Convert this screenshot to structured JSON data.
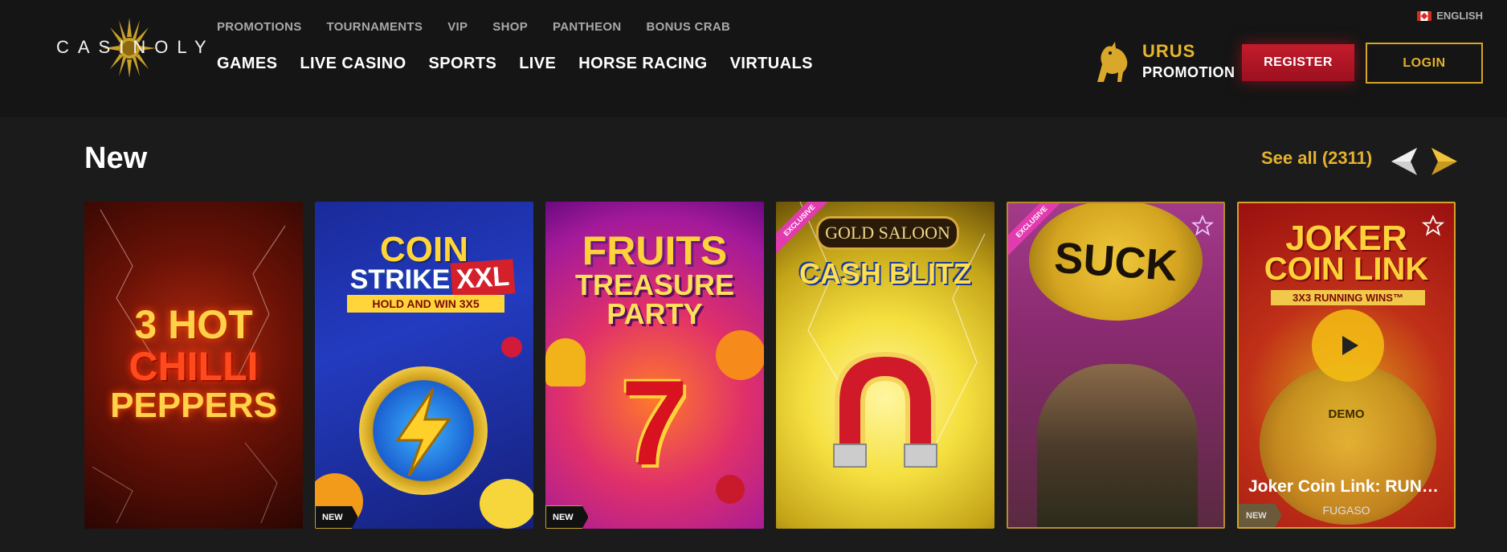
{
  "brand": {
    "logo_text": "CASINOLY"
  },
  "header": {
    "top_nav": [
      "PROMOTIONS",
      "TOURNAMENTS",
      "VIP",
      "SHOP",
      "PANTHEON",
      "BONUS CRAB"
    ],
    "main_nav": [
      "GAMES",
      "LIVE CASINO",
      "SPORTS",
      "LIVE",
      "HORSE RACING",
      "VIRTUALS"
    ],
    "language": "ENGLISH",
    "promo": {
      "line1": "URUS",
      "line2": "PROMOTION"
    },
    "register_label": "REGISTER",
    "login_label": "LOGIN"
  },
  "section": {
    "title": "New",
    "see_all": "See all (2311)",
    "prev_icon": "chevron-left-icon",
    "next_icon": "chevron-right-icon"
  },
  "games": [
    {
      "title_lines": [
        "3 HOT",
        "CHILLI",
        "PEPPERS"
      ],
      "badge": "",
      "exclusive": false
    },
    {
      "title_lines": [
        "COIN",
        "STRIKE",
        "XXL",
        "HOLD AND WIN 3X5"
      ],
      "badge": "NEW",
      "exclusive": false
    },
    {
      "title_lines": [
        "FRUITS",
        "TREASURE",
        "PARTY"
      ],
      "badge": "NEW",
      "exclusive": false
    },
    {
      "title_lines": [
        "GOLD SALOON",
        "CASH BLITZ"
      ],
      "badge": "",
      "exclusive": true,
      "exclusive_label": "EXCLUSIVE"
    },
    {
      "title_lines": [
        "SUCK"
      ],
      "badge": "",
      "exclusive": true,
      "exclusive_label": "EXCLUSIVE"
    },
    {
      "title_lines": [
        "JOKER",
        "COIN LINK",
        "3X3 RUNNING WINS™"
      ],
      "badge": "NEW",
      "exclusive": false,
      "hover": {
        "demo": "DEMO",
        "name": "Joker Coin Link: RUNNI...",
        "provider": "FUGASO"
      }
    }
  ],
  "colors": {
    "accent": "#e2b12e",
    "register": "#c31c2b",
    "background": "#1b1b1b",
    "header": "#151515"
  }
}
